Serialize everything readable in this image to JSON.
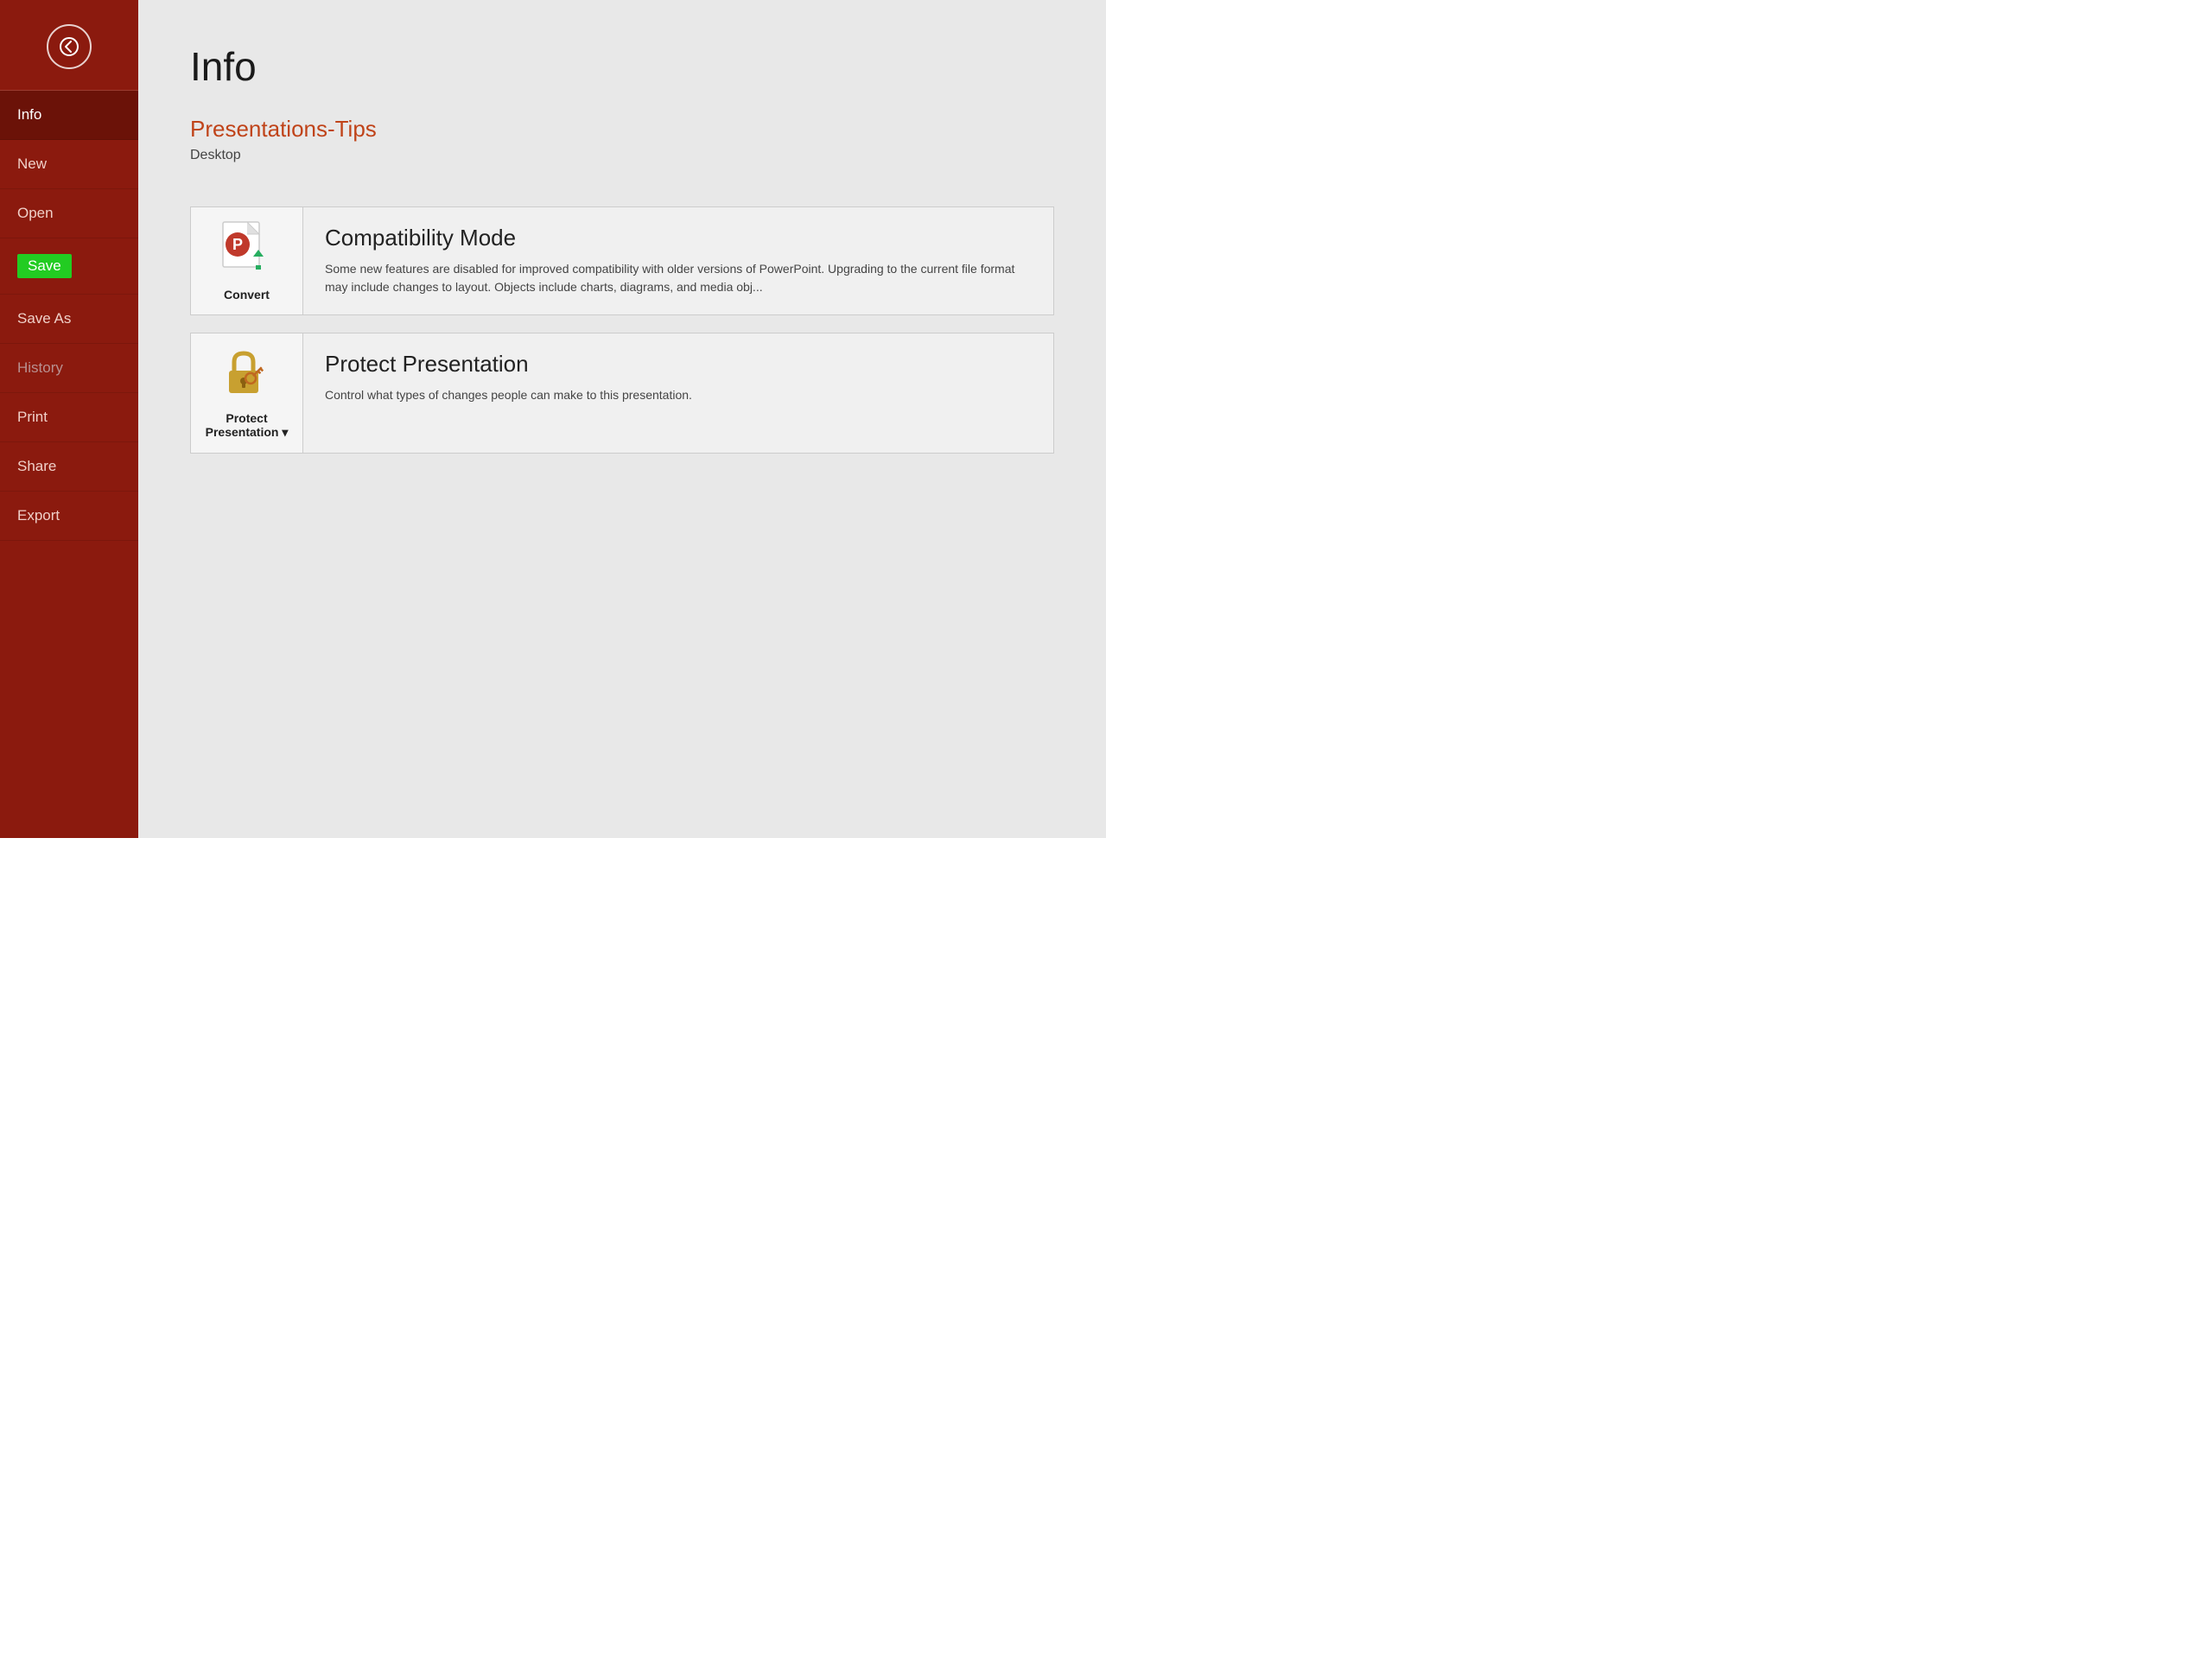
{
  "sidebar": {
    "nav_items": [
      {
        "id": "info",
        "label": "Info",
        "active": true,
        "save_highlight": false
      },
      {
        "id": "new",
        "label": "New",
        "active": false,
        "save_highlight": false
      },
      {
        "id": "open",
        "label": "Open",
        "active": false,
        "save_highlight": false
      },
      {
        "id": "save",
        "label": "Save",
        "active": false,
        "save_highlight": true
      },
      {
        "id": "saveas",
        "label": "Save As",
        "active": false,
        "save_highlight": false
      },
      {
        "id": "history",
        "label": "History",
        "active": false,
        "save_highlight": false
      },
      {
        "id": "print",
        "label": "Print",
        "active": false,
        "save_highlight": false
      },
      {
        "id": "share",
        "label": "Share",
        "active": false,
        "save_highlight": false
      },
      {
        "id": "export",
        "label": "Export",
        "active": false,
        "save_highlight": false
      }
    ]
  },
  "main": {
    "page_title": "Info",
    "file_title": "Presentations-Tips",
    "file_location": "Desktop",
    "cards": [
      {
        "id": "convert",
        "icon_label": "Convert",
        "heading": "Compatibility Mode",
        "desc": "Some new features are disabled for improved compatibility with older versions of PowerPoint. Upgrading to the current file format may include changes to layout. Objects include charts, diagrams, and media obj..."
      },
      {
        "id": "protect",
        "icon_label": "Protect\nPresentation",
        "heading": "Protect Presentation",
        "desc": "Control what types of changes people can make to this presentation."
      }
    ]
  }
}
